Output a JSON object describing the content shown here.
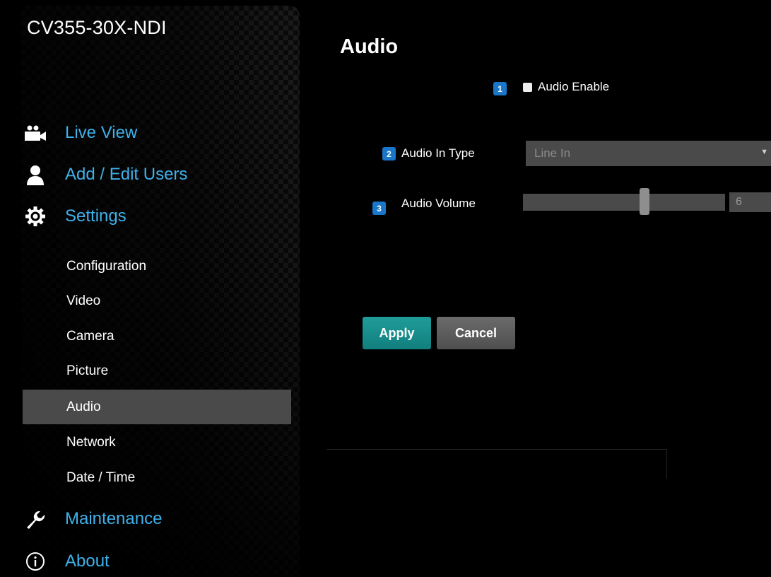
{
  "brand": {
    "name": "CV355-30X-NDI"
  },
  "nav": {
    "main": [
      {
        "label": "Live View",
        "icon": "video-camera-icon"
      },
      {
        "label": "Add / Edit Users",
        "icon": "user-icon"
      },
      {
        "label": "Settings",
        "icon": "gear-icon"
      },
      {
        "label": "Maintenance",
        "icon": "wrench-icon"
      },
      {
        "label": "About",
        "icon": "info-icon"
      }
    ],
    "settings_sub": [
      {
        "label": "Configuration",
        "active": false
      },
      {
        "label": "Video",
        "active": false
      },
      {
        "label": "Camera",
        "active": false
      },
      {
        "label": "Picture",
        "active": false
      },
      {
        "label": "Audio",
        "active": true
      },
      {
        "label": "Network",
        "active": false
      },
      {
        "label": "Date / Time",
        "active": false
      }
    ]
  },
  "page": {
    "title": "Audio",
    "audio_enable": {
      "badge": "1",
      "label": "Audio Enable",
      "checked": false
    },
    "audio_in_type": {
      "badge": "2",
      "label": "Audio In Type",
      "value": "Line In"
    },
    "audio_volume": {
      "badge": "3",
      "label": "Audio Volume",
      "value": "6",
      "level_fraction": 0.6
    },
    "buttons": {
      "apply": "Apply",
      "cancel": "Cancel"
    }
  },
  "colors": {
    "nav_main": "#3fb1ea",
    "active_bg": "#4a4a4a",
    "badge": "#1976c8",
    "apply": "#1a8f8d",
    "cancel": "#5e5e5e"
  }
}
